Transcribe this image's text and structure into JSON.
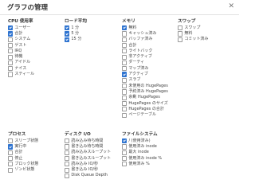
{
  "dialog": {
    "title": "グラフの管理",
    "close_icon": "close-icon"
  },
  "groups": [
    {
      "id": "cpu",
      "title": "CPU 使用率",
      "items": [
        {
          "label": "ユーザー",
          "checked": true
        },
        {
          "label": "合計",
          "checked": true
        },
        {
          "label": "システム",
          "checked": false
        },
        {
          "label": "ゲスト",
          "checked": false
        },
        {
          "label": "IRQ",
          "checked": false
        },
        {
          "label": "待機",
          "checked": false
        },
        {
          "label": "アイドル",
          "checked": false
        },
        {
          "label": "ナイス",
          "checked": false
        },
        {
          "label": "スティール",
          "checked": false
        }
      ]
    },
    {
      "id": "load",
      "title": "ロード平均",
      "items": [
        {
          "label": "1 分",
          "checked": true
        },
        {
          "label": "5 分",
          "checked": true
        },
        {
          "label": "15 分",
          "checked": true
        }
      ]
    },
    {
      "id": "memory",
      "title": "メモリ",
      "items": [
        {
          "label": "無料",
          "checked": true
        },
        {
          "label": "キャッシュ済み",
          "checked": false
        },
        {
          "label": "バッファ済み",
          "checked": false
        },
        {
          "label": "合計",
          "checked": false
        },
        {
          "label": "ライトバック",
          "checked": false
        },
        {
          "label": "非アクティブ",
          "checked": false
        },
        {
          "label": "ダーティ",
          "checked": false
        },
        {
          "label": "マップ済み",
          "checked": false
        },
        {
          "label": "アクティブ",
          "checked": true
        },
        {
          "label": "スラブ",
          "checked": false
        },
        {
          "label": "未使用の HugePages",
          "checked": false
        },
        {
          "label": "予約済み HugePages",
          "checked": false
        },
        {
          "label": "余剰 HugePages",
          "checked": false
        },
        {
          "label": "HugePages のサイズ",
          "checked": false
        },
        {
          "label": "HugePages の合計",
          "checked": false
        },
        {
          "label": "ページテーブル",
          "checked": false
        }
      ]
    },
    {
      "id": "swap",
      "title": "スワップ",
      "items": [
        {
          "label": "スワップ",
          "checked": false
        },
        {
          "label": "無料",
          "checked": false
        },
        {
          "label": "コミット済み",
          "checked": false
        }
      ]
    },
    {
      "id": "process",
      "title": "プロセス",
      "items": [
        {
          "label": "スリープ状態",
          "checked": false
        },
        {
          "label": "実行中",
          "checked": true
        },
        {
          "label": "合計",
          "checked": false
        },
        {
          "label": "停止",
          "checked": false
        },
        {
          "label": "ブロック状態",
          "checked": false
        },
        {
          "label": "ゾンビ状態",
          "checked": false
        }
      ]
    },
    {
      "id": "disk",
      "title": "ディスク I/O",
      "items": [
        {
          "label": "読み込み待ち時間",
          "checked": false
        },
        {
          "label": "書き込み待ち時間",
          "checked": false
        },
        {
          "label": "読み込みスループット",
          "checked": false
        },
        {
          "label": "書き込みスループット",
          "checked": false
        },
        {
          "label": "読み込み IO/秒",
          "checked": false
        },
        {
          "label": "書き込み IO/秒",
          "checked": false
        },
        {
          "label": "Disk Queue Depth",
          "checked": false
        }
      ]
    },
    {
      "id": "fs",
      "title": "ファイルシステム",
      "items": [
        {
          "label": "/ (使用済み)",
          "checked": true
        },
        {
          "label": "使用済み inode",
          "checked": false
        },
        {
          "label": "最大 inode",
          "checked": false
        },
        {
          "label": "使用済み inode %",
          "checked": false
        },
        {
          "label": "使用済み %",
          "checked": false
        }
      ]
    }
  ]
}
